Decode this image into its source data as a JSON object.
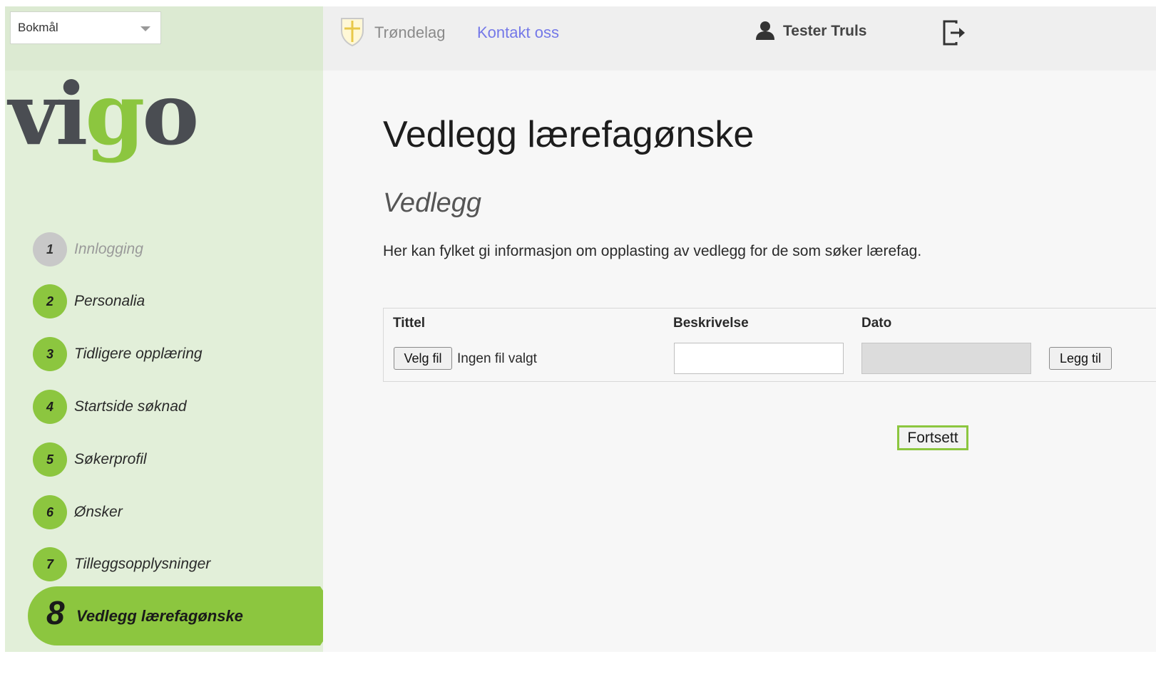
{
  "language_selector": {
    "value": "Bokmål"
  },
  "logo": {
    "part1": "vi",
    "part2": "g",
    "part3": "o"
  },
  "header": {
    "county": "Trøndelag",
    "contact_link": "Kontakt oss",
    "user_name": "Tester Truls"
  },
  "steps": [
    {
      "number": "1",
      "label": "Innlogging",
      "state": "done"
    },
    {
      "number": "2",
      "label": "Personalia",
      "state": "todo"
    },
    {
      "number": "3",
      "label": "Tidligere opplæring",
      "state": "todo"
    },
    {
      "number": "4",
      "label": "Startside søknad",
      "state": "todo"
    },
    {
      "number": "5",
      "label": "Søkerprofil",
      "state": "todo"
    },
    {
      "number": "6",
      "label": "Ønsker",
      "state": "todo"
    },
    {
      "number": "7",
      "label": "Tilleggsopplysninger",
      "state": "todo"
    },
    {
      "number": "8",
      "label": "Vedlegg lærefagønske",
      "state": "active"
    }
  ],
  "main": {
    "title": "Vedlegg lærefagønske",
    "section_title": "Vedlegg",
    "info_text": "Her kan fylket gi informasjon om opplasting av vedlegg for de som søker lærefag.",
    "columns": {
      "title": "Tittel",
      "description": "Beskrivelse",
      "date": "Dato"
    },
    "choose_file_label": "Velg fil",
    "no_file_text": "Ingen fil valgt",
    "description_value": "",
    "date_value": "",
    "add_label": "Legg til",
    "continue_label": "Fortsett"
  },
  "colors": {
    "accent_green": "#8cc63f",
    "sidebar_bg": "#e2efd9",
    "link_blue": "#7478e8",
    "logo_dark": "#4a4d52"
  }
}
